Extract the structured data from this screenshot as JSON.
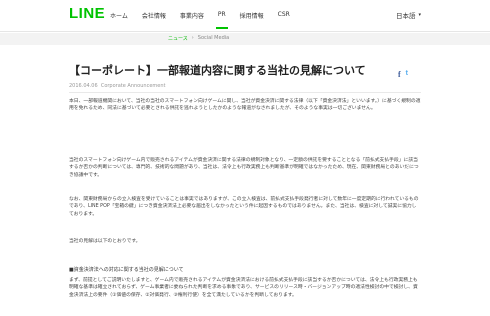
{
  "header": {
    "logo": "LINE",
    "nav": [
      {
        "label": "ホーム"
      },
      {
        "label": "会社情報"
      },
      {
        "label": "事業内容"
      },
      {
        "label": "PR"
      },
      {
        "label": "採用情報"
      },
      {
        "label": "CSR"
      }
    ],
    "active_nav": "PR",
    "language": "日本語",
    "caret": "▾"
  },
  "breadcrumb": {
    "items": [
      "ニュース",
      "Social Media"
    ],
    "separator": "›"
  },
  "article": {
    "title": "【コーポレート】一部報道内容に関する当社の見解について",
    "share": {
      "facebook": "f",
      "twitter": "t"
    },
    "date": "2016.04.06",
    "category": "Corporate Announcement",
    "paragraphs": [
      "本日、一部報道機関において、当社の当社のスマートフォン向けゲームに関し、当社が資金決済に関する法律（以下「資金決済法」といいます。）に基づく規制の適用を免れるため、同法に基づいて必要とされる供託を逃れようとしたかのような報道がなされましたが、そのような事実は一切ございません。",
      "当社のスマートフォン向けゲーム内で販売されるアイテムが資金決済に関する法律の規制対象となり、一定額の供託を要することとなる「前払式支払手段」に該当するか否かの判断については、専門的、技術的な問題があり、当社は、法令上も行政実務上も判断基準が明確ではなかったため、現在、関東財務局とのあいだにつき協議中です。",
      "なお、関東財務局からの立入検査を受けていることは事実ではありますが、この立入検査は、前払式支払手段発行者に対して数年に一度定期的に行われているものであり、LINE POP「宝箱の鍵」につき資金決済法上必要な届出をしなかったという件に起因するものではありません。また、当社は、検査に対して誠実に協力しております。",
      "当社の見解は以下のとおりです。"
    ],
    "section_heading": "■資金決済法への対応に関する当社の見解について",
    "section_paragraph": "まず、前提としてご説明いたしますと、ゲーム内で販売されるアイテムが資金決済法における前払式支払手段に該当するか否かについては、法令上も行政実務上も明確な基準は確立されておらず、ゲーム事業者に委ねられた判断を求める事象であり、サービスのリリース時・バージョンアップ時の適法性検討の中で検討し、資金決済法上の要件（①価値の保存、②対価発行、③権利行使）を全て満たしているかを判断しております。"
  }
}
